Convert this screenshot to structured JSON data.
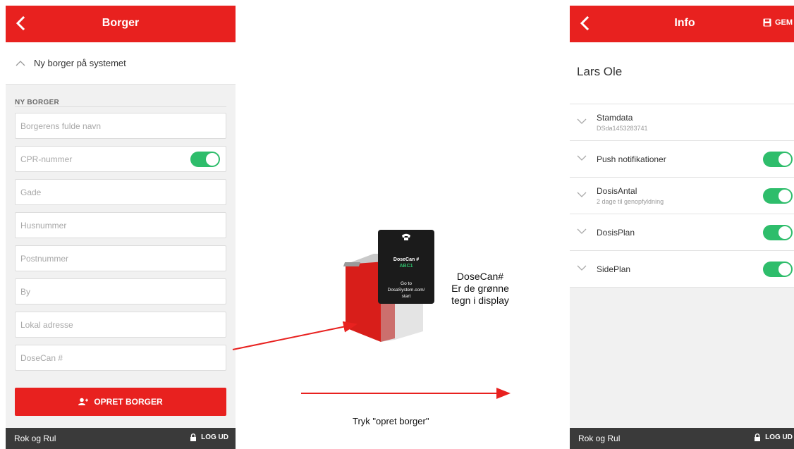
{
  "left_screen": {
    "title": "Borger",
    "section_header": "Ny borger på systemet",
    "form_label": "NY BORGER",
    "fields": [
      {
        "placeholder": "Borgerens fulde navn"
      },
      {
        "placeholder": "CPR-nummer"
      },
      {
        "placeholder": "Gade"
      },
      {
        "placeholder": "Husnummer"
      },
      {
        "placeholder": "Postnummer"
      },
      {
        "placeholder": "By"
      },
      {
        "placeholder": "Lokal adresse"
      },
      {
        "placeholder": "DoseCan #"
      }
    ],
    "cpr_toggle_on": true,
    "primary_button": "OPRET BORGER",
    "footer_brand": "Rok og Rul",
    "footer_logout": "LOG UD"
  },
  "device": {
    "screen_line1": "DoseCan #",
    "screen_code": "ABC1",
    "screen_line2": "Go to",
    "screen_line3": "DosaSystem.com/",
    "screen_line4": "start"
  },
  "annotations": {
    "right_caption_1": "DoseCan#",
    "right_caption_2": "Er de grønne",
    "right_caption_3": "tegn i display",
    "bottom_caption": "Tryk  \"opret borger\""
  },
  "right_screen": {
    "title": "Info",
    "save_label": "GEM",
    "person_name": "Lars Ole",
    "rows": [
      {
        "label": "Stamdata",
        "sub": "DSda1453283741",
        "toggle": false
      },
      {
        "label": "Push notifikationer",
        "sub": "",
        "toggle": true
      },
      {
        "label": "DosisAntal",
        "sub": "2 dage til genopfyldning",
        "toggle": true
      },
      {
        "label": "DosisPlan",
        "sub": "",
        "toggle": true
      },
      {
        "label": "SidePlan",
        "sub": "",
        "toggle": true
      }
    ],
    "footer_brand": "Rok og Rul",
    "footer_logout": "LOG UD"
  },
  "colors": {
    "brand_red": "#e8211f",
    "toggle_green": "#2ebd6b",
    "footer_dark": "#3a3a3a"
  }
}
